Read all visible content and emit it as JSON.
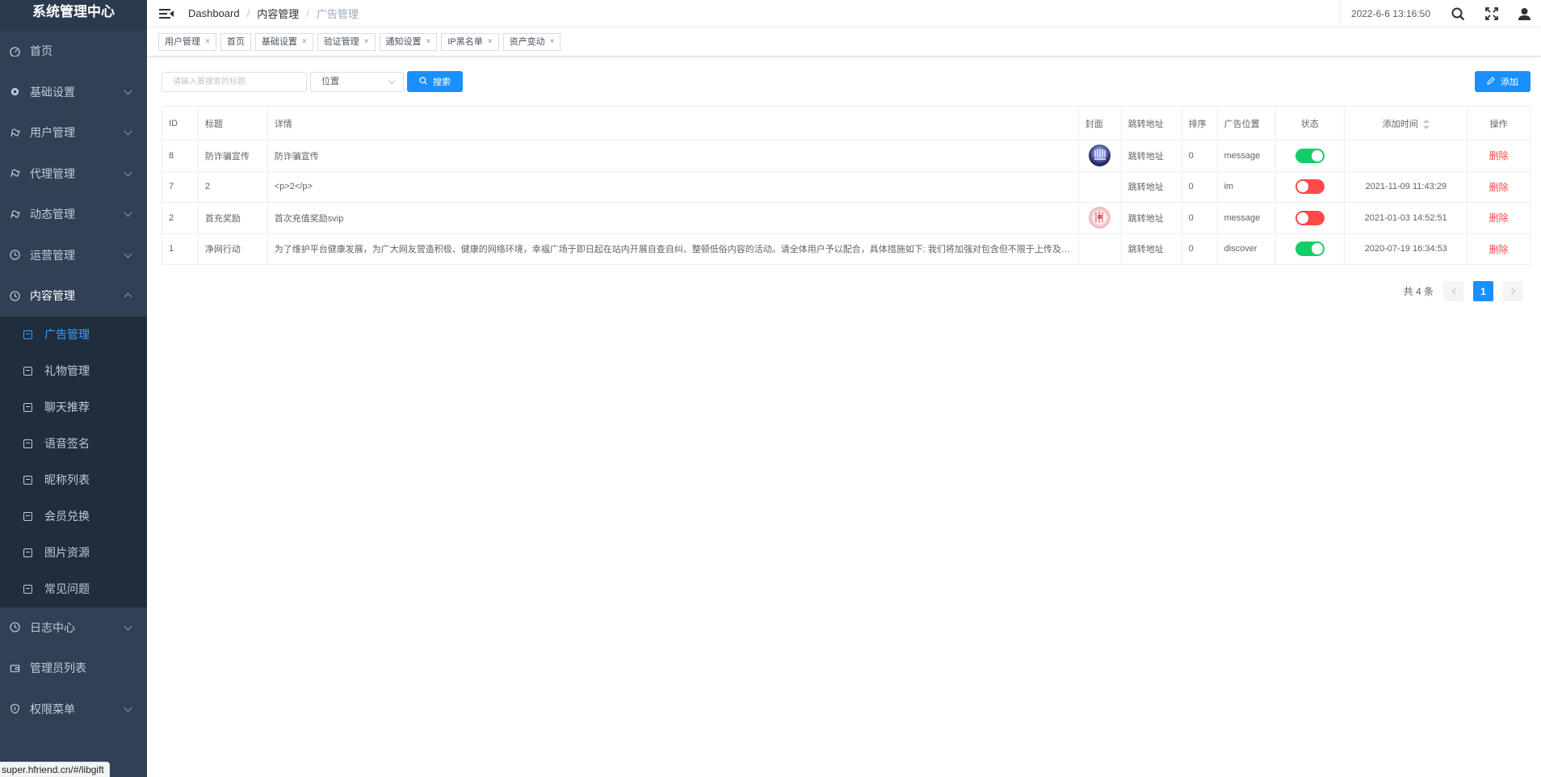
{
  "sidebar": {
    "title": "系统管理中心",
    "menu_top": [
      {
        "label": "首页"
      },
      {
        "label": "基础设置"
      },
      {
        "label": "用户管理"
      },
      {
        "label": "代理管理"
      },
      {
        "label": "动态管理"
      },
      {
        "label": "运营管理"
      },
      {
        "label": "内容管理"
      }
    ],
    "submenu": [
      {
        "label": "广告管理"
      },
      {
        "label": "礼物管理"
      },
      {
        "label": "聊天推荐"
      },
      {
        "label": "语音签名"
      },
      {
        "label": "昵称列表"
      },
      {
        "label": "会员兑换"
      },
      {
        "label": "图片资源"
      },
      {
        "label": "常见问题"
      }
    ],
    "menu_bottom": [
      {
        "label": "日志中心"
      },
      {
        "label": "管理员列表"
      },
      {
        "label": "权限菜单"
      }
    ]
  },
  "navbar": {
    "breadcrumb": [
      "Dashboard",
      "/",
      "内容管理",
      "/",
      "广告管理"
    ],
    "time": "2022-6-6 13:16:50"
  },
  "tags": [
    "用户管理",
    "首页",
    "基础设置",
    "验证管理",
    "通知设置",
    "IP黑名单",
    "资产变动"
  ],
  "filter": {
    "search_placeholder": "请输入要搜索的标题",
    "position_select": "位置",
    "search_label": "搜索",
    "add_label": "添加"
  },
  "table": {
    "headers": [
      "ID",
      "标题",
      "详情",
      "封面",
      "跳转地址",
      "排序",
      "广告位置",
      "状态",
      "添加时间",
      "操作"
    ],
    "rows": [
      {
        "id": "8",
        "title": "防诈骗宣传",
        "detail": "防诈骗宣传",
        "cover": "dark-blue",
        "jump": "跳转地址",
        "sort": "0",
        "position": "message",
        "status": true,
        "time": "",
        "action": "删除"
      },
      {
        "id": "7",
        "title": "2",
        "detail": "<p>2</p>",
        "cover": "",
        "jump": "跳转地址",
        "sort": "0",
        "position": "im",
        "status": false,
        "time": "2021-11-09 11:43:29",
        "action": "删除"
      },
      {
        "id": "2",
        "title": "首充奖励",
        "detail": "首次充值奖励svip",
        "cover": "pink",
        "jump": "跳转地址",
        "sort": "0",
        "position": "message",
        "status": false,
        "time": "2021-01-03 14:52:51",
        "action": "删除"
      },
      {
        "id": "1",
        "title": "净网行动",
        "detail": "为了维护平台健康发展，为广大网友营造积极、健康的网络环境，幸福广场于即日起在站内开展自查自纠、整顿低俗内容的活动。请全体用户予以配合，具体措施如下: 我们将加强对包含但不限于上传及发...",
        "cover": "",
        "jump": "跳转地址",
        "sort": "0",
        "position": "discover",
        "status": true,
        "time": "2020-07-19 16:34:53",
        "action": "删除"
      }
    ]
  },
  "pager": {
    "total": "共 4 条",
    "current": "1"
  },
  "status_url": "super.hfriend.cn/#/libgift",
  "colors": {
    "sidebar": "#304156",
    "submenu": "#1f2d3d",
    "primary": "#1890ff",
    "active": "#409eff",
    "switch_on": "#13ce66",
    "switch_off": "#ff4949"
  }
}
